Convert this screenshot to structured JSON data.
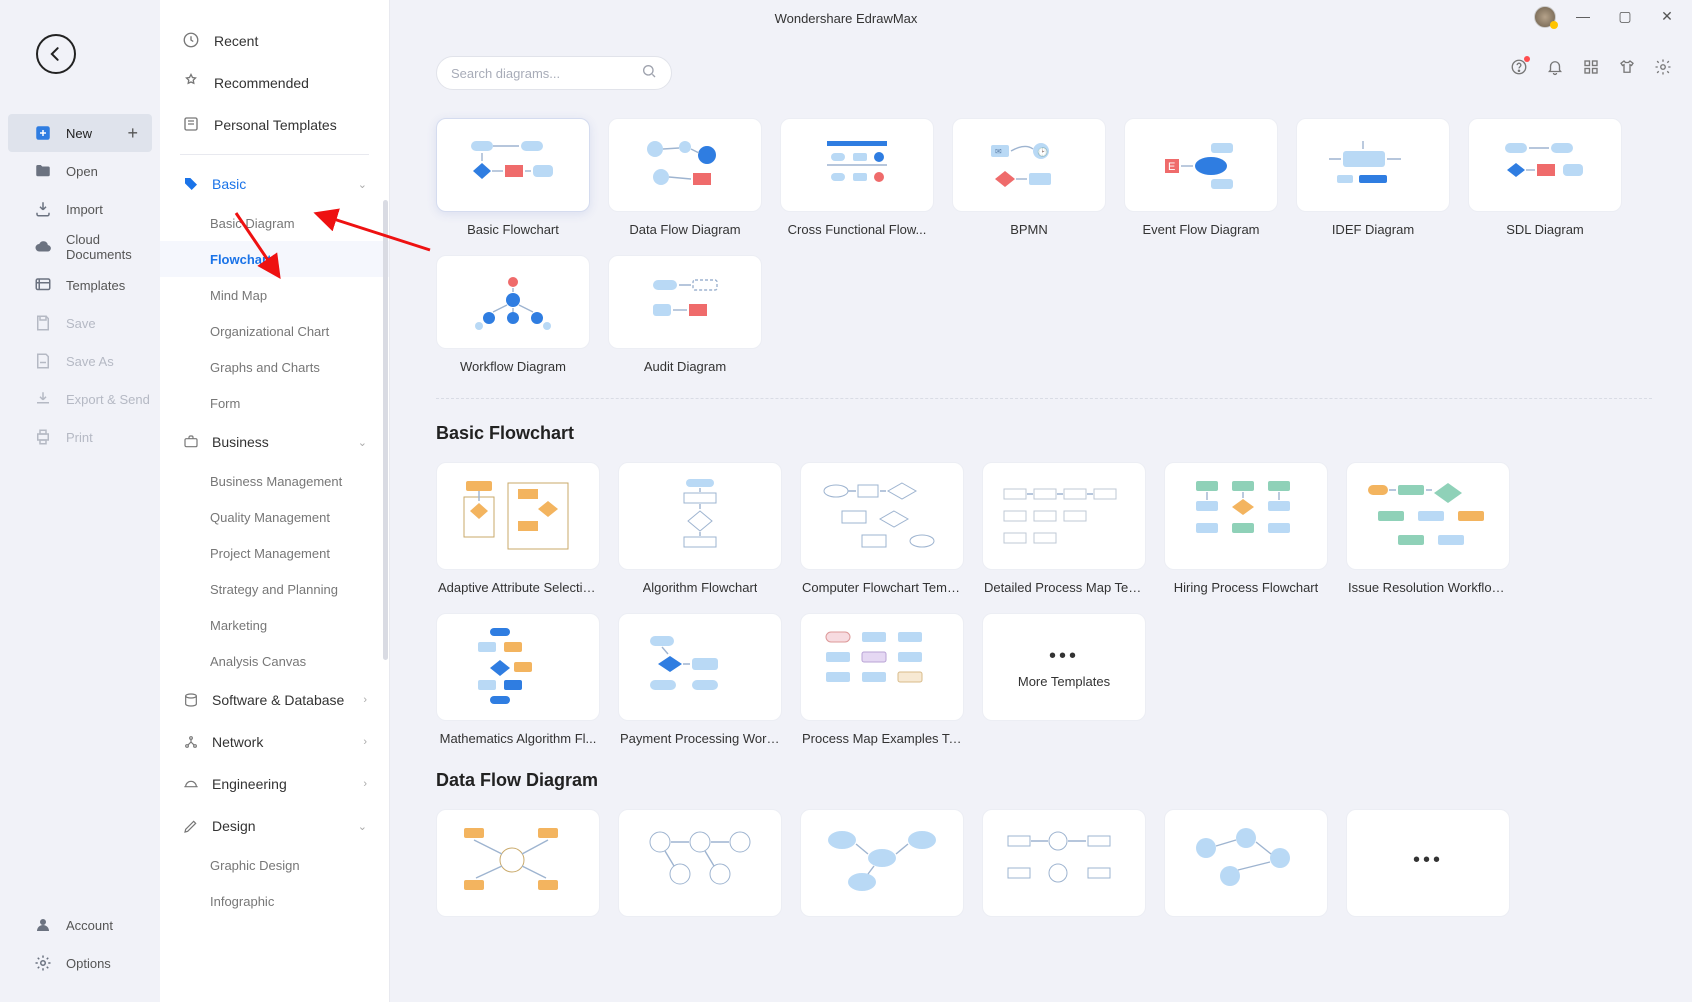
{
  "app_title": "Wondershare EdrawMax",
  "window": {
    "min": "—",
    "max": "▢",
    "close": "✕"
  },
  "rail": {
    "new": "New",
    "open": "Open",
    "import": "Import",
    "cloud": "Cloud Documents",
    "templates": "Templates",
    "save": "Save",
    "save_as": "Save As",
    "export": "Export & Send",
    "print": "Print",
    "account": "Account",
    "options": "Options"
  },
  "nav": {
    "recent": "Recent",
    "recommended": "Recommended",
    "personal": "Personal Templates",
    "categories": [
      {
        "label": "Basic",
        "active": true,
        "items": [
          "Basic Diagram",
          "Flowchart",
          "Mind Map",
          "Organizational Chart",
          "Graphs and Charts",
          "Form"
        ],
        "active_item": "Flowchart"
      },
      {
        "label": "Business",
        "items": [
          "Business Management",
          "Quality Management",
          "Project Management",
          "Strategy and Planning",
          "Marketing",
          "Analysis Canvas"
        ]
      },
      {
        "label": "Software & Database",
        "collapsed": true
      },
      {
        "label": "Network",
        "collapsed": true
      },
      {
        "label": "Engineering",
        "collapsed": true
      },
      {
        "label": "Design",
        "items": [
          "Graphic Design",
          "Infographic"
        ]
      }
    ]
  },
  "search": {
    "placeholder": "Search diagrams..."
  },
  "top_templates": [
    "Basic Flowchart",
    "Data Flow Diagram",
    "Cross Functional Flow...",
    "BPMN",
    "Event Flow Diagram",
    "IDEF Diagram",
    "SDL Diagram",
    "Workflow Diagram",
    "Audit Diagram"
  ],
  "sections": [
    {
      "title": "Basic Flowchart",
      "items": [
        "Adaptive Attribute Selectio...",
        "Algorithm Flowchart",
        "Computer Flowchart Temp...",
        "Detailed Process Map Tem...",
        "Hiring Process Flowchart",
        "Issue Resolution Workflow ...",
        "Mathematics Algorithm Fl...",
        "Payment Processing Workf...",
        "Process Map Examples Te..."
      ],
      "more": "More Templates"
    },
    {
      "title": "Data Flow Diagram",
      "items": [
        "",
        "",
        "",
        "",
        "",
        ""
      ],
      "more": ""
    }
  ]
}
